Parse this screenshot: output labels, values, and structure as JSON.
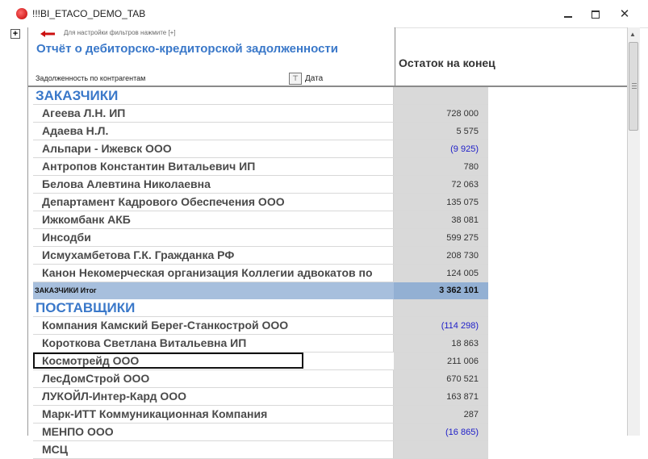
{
  "window": {
    "title": "!!!BI_ETACO_DEMO_TAB",
    "close_glyph": "✕"
  },
  "report": {
    "expander_glyph": "+",
    "filter_hint": "Для настройки фильтров нажмите [+]",
    "title": "Отчёт о дебиторско-кредиторской задолженности",
    "row_group_label": "Задолженность по контрагентам",
    "filter_glyph": "⊤",
    "date_label": "Дата",
    "value_column": "Остаток на конец"
  },
  "sections": [
    {
      "name": "ЗАКАЗЧИКИ",
      "rows": [
        {
          "name": "Агеева Л.Н. ИП",
          "value": "728 000"
        },
        {
          "name": "Адаева Н.Л.",
          "value": "5 575"
        },
        {
          "name": "Альпари - Ижевск ООО",
          "value": "(9 925)"
        },
        {
          "name": "Антропов Константин Витальевич ИП",
          "value": "780"
        },
        {
          "name": "Белова Алевтина Николаевна",
          "value": "72 063"
        },
        {
          "name": "Департамент Кадрового Обеспечения ООО",
          "value": "135 075"
        },
        {
          "name": "Ижкомбанк АКБ",
          "value": "38 081"
        },
        {
          "name": "Инсодби",
          "value": "599 275"
        },
        {
          "name": "Исмухамбетова Г.К. Гражданка РФ",
          "value": "208 730"
        },
        {
          "name": "Канон Некомерческая организация Коллегии адвокатов по",
          "value": "124 005"
        }
      ],
      "total_label": "ЗАКАЗЧИКИ Итог",
      "total_value": "3 362 101"
    },
    {
      "name": "ПОСТАВЩИКИ",
      "rows": [
        {
          "name": "Компания Камский Берег-Станкострой ООО",
          "value": "(114 298)"
        },
        {
          "name": "Короткова Светлана Витальевна ИП",
          "value": "18 863"
        },
        {
          "name": "Космотрейд ООО",
          "value": "211 006"
        },
        {
          "name": "ЛесДомСтрой ООО",
          "value": "670 521"
        },
        {
          "name": "ЛУКОЙЛ-Интер-Кард ООО",
          "value": "163 871"
        },
        {
          "name": "Марк-ИТТ Коммуникационная Компания",
          "value": "287"
        },
        {
          "name": "МЕНПО ООО",
          "value": "(16 865)"
        },
        {
          "name": "МСЦ",
          "value": ""
        }
      ]
    }
  ],
  "colors": {
    "title_blue": "#3a78c9",
    "negative": "#2020c8",
    "total_band": "#a7bfdd"
  }
}
